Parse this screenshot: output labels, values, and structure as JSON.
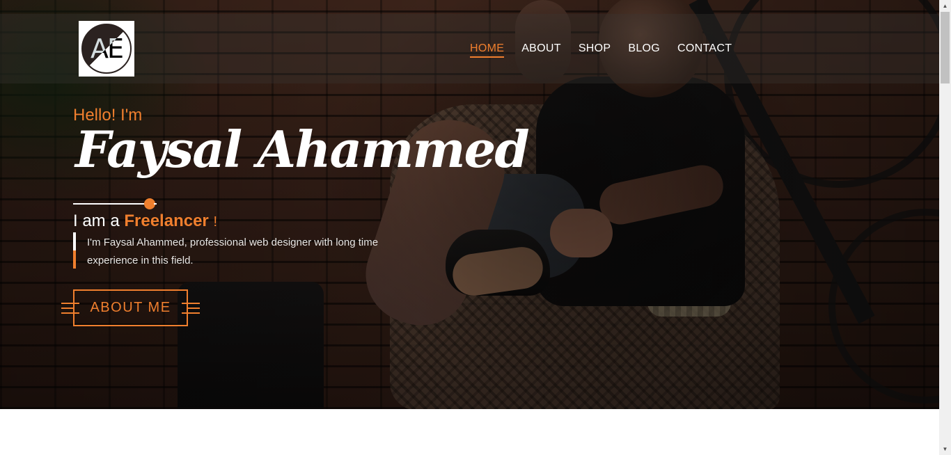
{
  "brand": {
    "logo_text": "AE"
  },
  "nav": {
    "items": [
      {
        "label": "HOME",
        "active": true
      },
      {
        "label": "ABOUT",
        "active": false
      },
      {
        "label": "SHOP",
        "active": false
      },
      {
        "label": "BLOG",
        "active": false
      },
      {
        "label": "CONTACT",
        "active": false
      }
    ]
  },
  "hero": {
    "greeting": "Hello! I'm",
    "name": "Faysal Ahammed",
    "role_prefix": "I am a ",
    "role_highlight": "Freelancer",
    "role_suffix": "!",
    "bio": "I'm Faysal Ahammed, professional web designer with long time experience in this field.",
    "cta_label": "ABOUT ME"
  },
  "colors": {
    "accent": "#f07f2e",
    "text_light": "#ffffff",
    "page_bg": "#ffffff"
  },
  "icons": {
    "scroll_up": "scroll-up-arrow-icon",
    "scroll_down": "scroll-down-arrow-icon"
  }
}
